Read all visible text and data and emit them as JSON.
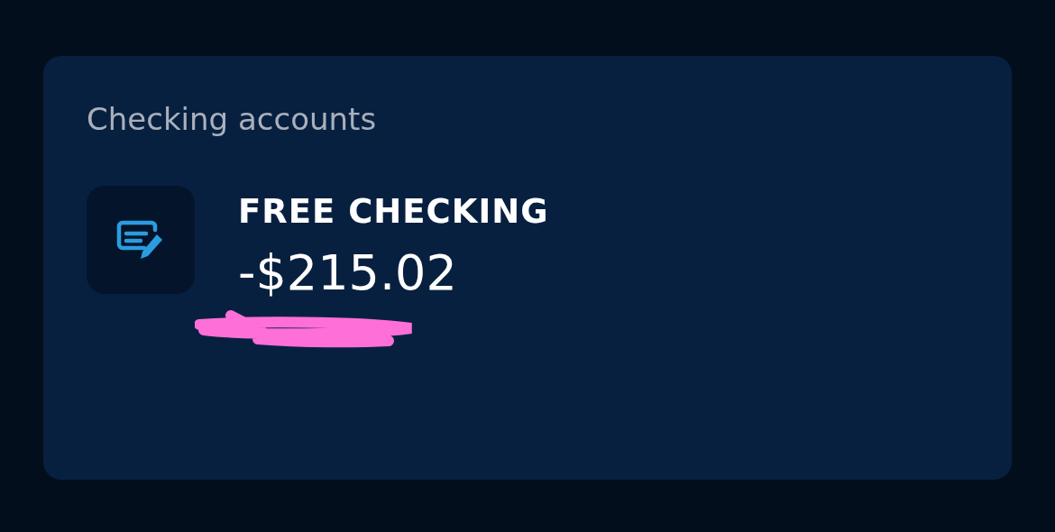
{
  "section": {
    "title": "Checking accounts"
  },
  "accounts": [
    {
      "name": "FREE CHECKING",
      "balance": "-$215.02",
      "redacted": true
    }
  ]
}
